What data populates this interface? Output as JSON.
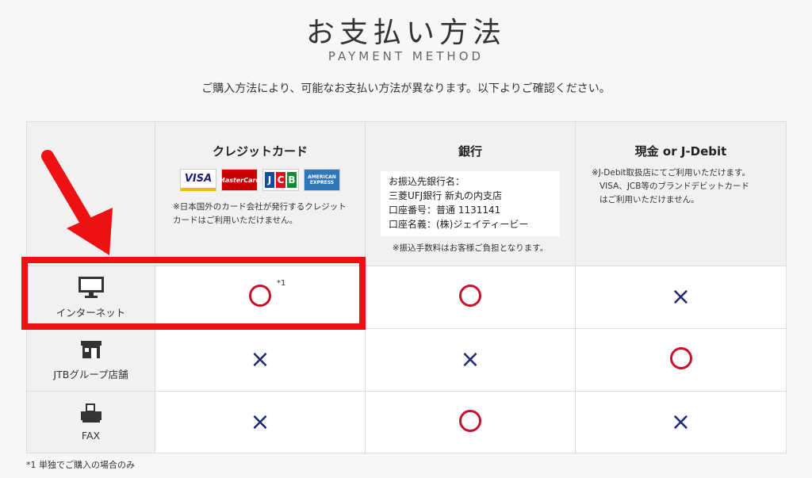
{
  "page": {
    "title": "お支払い方法",
    "subtitle": "PAYMENT METHOD",
    "lead": "ご購入方法により、可能なお支払い方法が異なります。以下よりご確認ください。",
    "footnote": "*1 単独でご購入の場合のみ"
  },
  "columns": {
    "credit": {
      "title": "クレジットカード",
      "card_logos": [
        "VISA",
        "MasterCard",
        "JCB",
        "AMERICAN EXPRESS"
      ],
      "note": "※日本国外のカード会社が発行するクレジットカードはご利用いただけません。"
    },
    "bank": {
      "title": "銀行",
      "box_lines": [
        "お振込先銀行名：",
        "三菱UFJ銀行 新丸の内支店",
        "口座番号：普通 1131141",
        "口座名義：(株)ジェイティービー"
      ],
      "note": "※振込手数料はお客様ご負担となります。"
    },
    "cash": {
      "title": "現金 or J-Debit",
      "note_lines": [
        "※J-Debit取扱店にてご利用いただけます。",
        "VISA、JCB等のブランドデビットカード",
        "はご利用いただけません。"
      ]
    }
  },
  "rows": [
    {
      "label": "インターネット",
      "icon": "monitor-icon",
      "credit": "○",
      "credit_sup": "*1",
      "bank": "○",
      "cash": "×"
    },
    {
      "label": "JTBグループ店舗",
      "icon": "store-icon",
      "credit": "×",
      "bank": "×",
      "cash": "○"
    },
    {
      "label": "FAX",
      "icon": "fax-icon",
      "credit": "×",
      "bank": "○",
      "cash": "×"
    }
  ],
  "colors": {
    "circle": "#c8102e",
    "cross": "#1f2a70",
    "highlight": "#ee1111"
  }
}
